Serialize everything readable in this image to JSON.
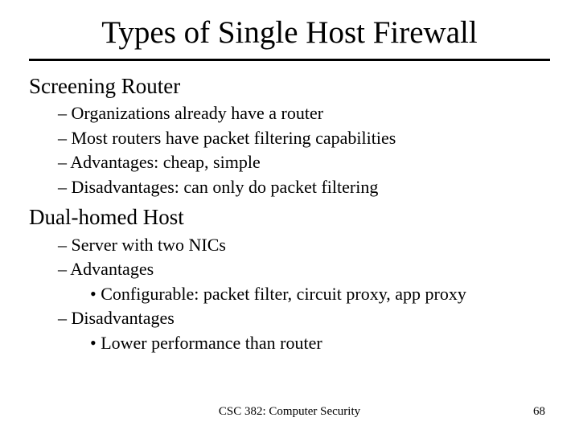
{
  "title": "Types of Single Host Firewall",
  "sections": [
    {
      "heading": "Screening Router",
      "items": [
        {
          "text": "Organizations already have a router"
        },
        {
          "text": "Most routers have packet filtering capabilities"
        },
        {
          "text": "Advantages: cheap, simple"
        },
        {
          "text": "Disadvantages: can only do packet filtering"
        }
      ]
    },
    {
      "heading": "Dual-homed Host",
      "items": [
        {
          "text": "Server with two NICs"
        },
        {
          "text": "Advantages",
          "sub": [
            "Configurable: packet filter, circuit proxy, app proxy"
          ]
        },
        {
          "text": "Disadvantages",
          "sub": [
            "Lower performance than router"
          ]
        }
      ]
    }
  ],
  "footer": {
    "course": "CSC 382: Computer Security",
    "page": "68"
  }
}
